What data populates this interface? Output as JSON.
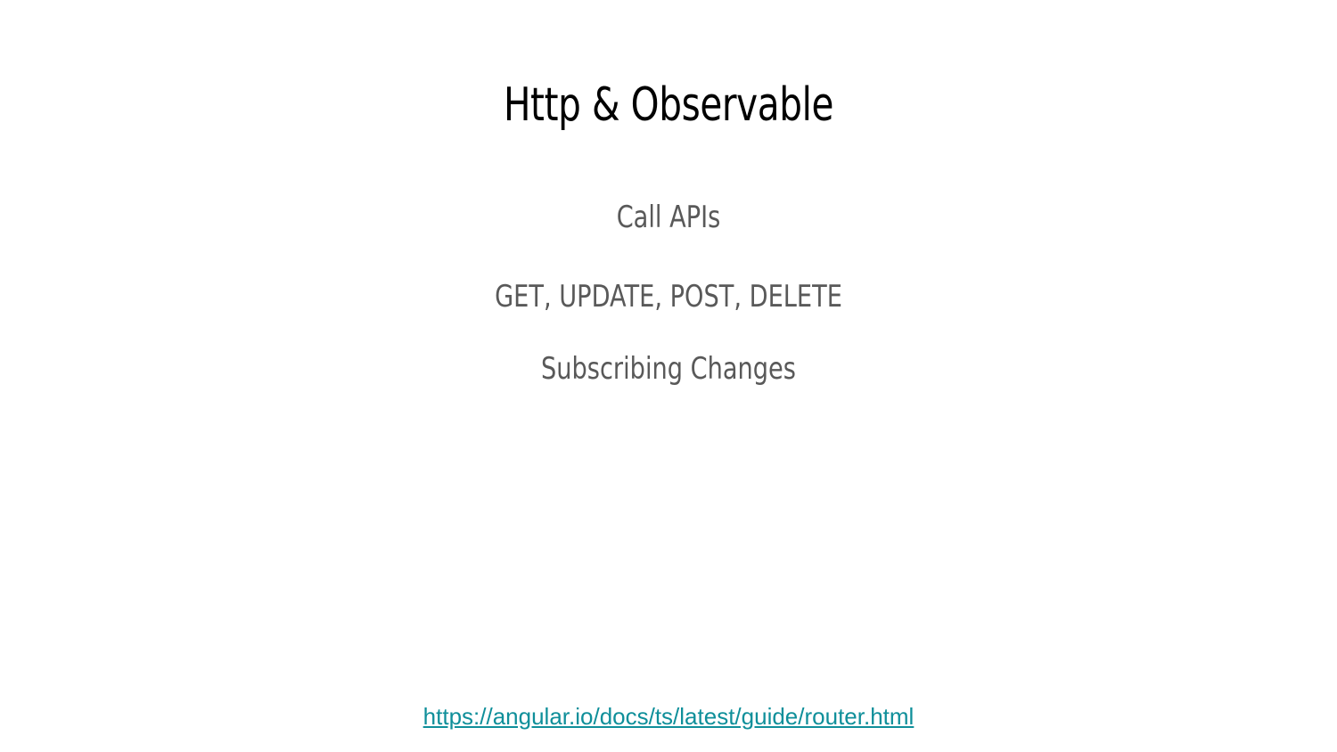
{
  "slide": {
    "title": "Http & Observable",
    "bullets": [
      "Call APIs",
      "GET, UPDATE, POST, DELETE",
      "Subscribing Changes"
    ],
    "link_text": "https://angular.io/docs/ts/latest/guide/router.html",
    "colors": {
      "title": "#000000",
      "body": "#595959",
      "link": "#0f8f9a"
    }
  }
}
